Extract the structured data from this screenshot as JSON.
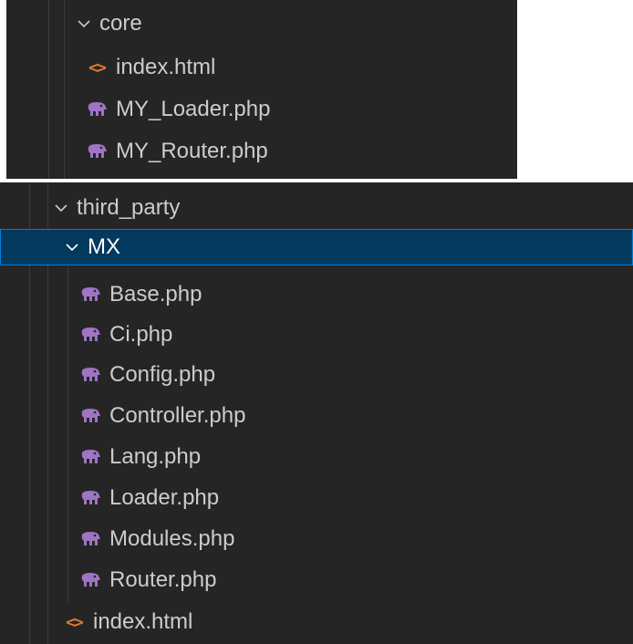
{
  "top_panel": {
    "folder": {
      "label": "core",
      "expanded": true
    },
    "files": [
      {
        "label": "index.html",
        "type": "html"
      },
      {
        "label": "MY_Loader.php",
        "type": "php"
      },
      {
        "label": "MY_Router.php",
        "type": "php"
      }
    ]
  },
  "bottom_panel": {
    "folder": {
      "label": "third_party",
      "expanded": true
    },
    "subfolder": {
      "label": "MX",
      "expanded": true,
      "selected": true
    },
    "files": [
      {
        "label": "Base.php",
        "type": "php"
      },
      {
        "label": "Ci.php",
        "type": "php"
      },
      {
        "label": "Config.php",
        "type": "php"
      },
      {
        "label": "Controller.php",
        "type": "php"
      },
      {
        "label": "Lang.php",
        "type": "php"
      },
      {
        "label": "Loader.php",
        "type": "php"
      },
      {
        "label": "Modules.php",
        "type": "php"
      },
      {
        "label": "Router.php",
        "type": "php"
      }
    ],
    "trailing_file": {
      "label": "index.html",
      "type": "html"
    }
  },
  "colors": {
    "panel_bg": "#252526",
    "text": "#cccccc",
    "selection_bg": "#04395e",
    "selection_border": "#007fd4",
    "php_icon": "#a074c4",
    "html_icon": "#e37933"
  },
  "icons": {
    "chevron": "chevron-down-icon",
    "php": "php-elephant-icon",
    "html": "html-code-icon"
  }
}
